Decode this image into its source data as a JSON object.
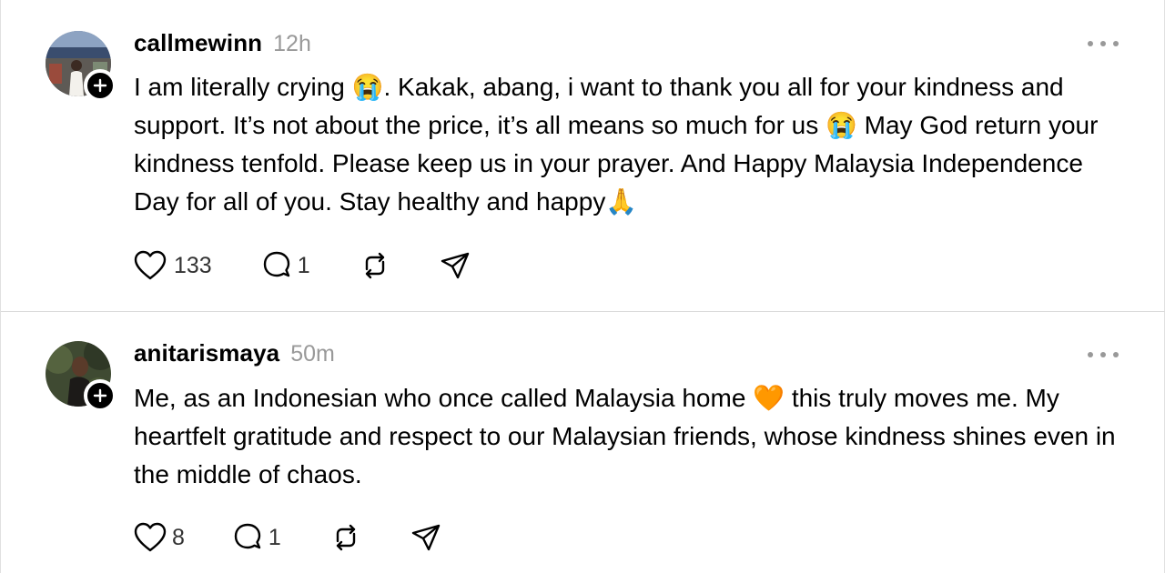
{
  "posts": [
    {
      "username": "callmewinn",
      "time": "12h",
      "text": "I am literally crying 😭. Kakak, abang, i want to thank you all for your kindness and support. It’s not about the price, it’s all means so much for us 😭 May God return your kindness tenfold. Please keep us in your prayer. And Happy Malaysia Independence Day for all of you. Stay healthy and happy🙏",
      "likes": "133",
      "replies": "1"
    },
    {
      "username": "anitarismaya",
      "time": "50m",
      "text": "Me, as an Indonesian who once called Malaysia home 🧡 this truly moves me. My heartfelt gratitude and respect to our Malaysian friends, whose kindness shines even in the middle of chaos.",
      "likes": "8",
      "replies": "1"
    }
  ],
  "icons": {
    "like": "heart-icon",
    "reply": "comment-icon",
    "repost": "repost-icon",
    "share": "send-icon",
    "more": "more-icon",
    "follow": "plus-icon"
  },
  "colors": {
    "text": "#000000",
    "muted": "#999999",
    "divider": "#dbdbdb"
  }
}
